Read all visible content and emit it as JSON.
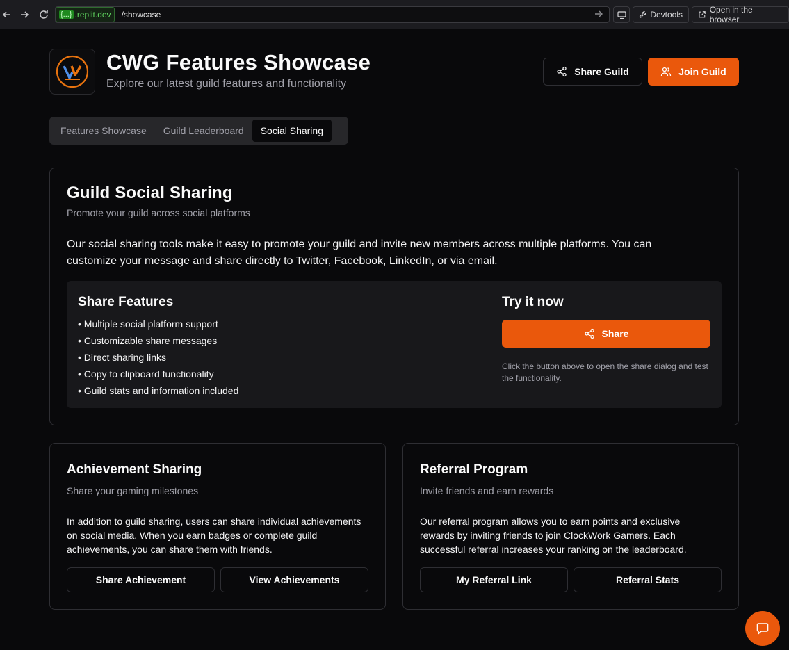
{
  "browser": {
    "url_domain_badge": "{...}",
    "url_domain": ".replit.dev",
    "url_path": "/showcase",
    "devtools_label": "Devtools",
    "open_browser_label": "Open in the browser"
  },
  "header": {
    "title": "CWG Features Showcase",
    "subtitle": "Explore our latest guild features and functionality",
    "share_guild_label": "Share Guild",
    "join_guild_label": "Join Guild"
  },
  "tabs": [
    {
      "label": "Features Showcase",
      "active": false
    },
    {
      "label": "Guild Leaderboard",
      "active": false
    },
    {
      "label": "Social Sharing",
      "active": true
    }
  ],
  "social_card": {
    "title": "Guild Social Sharing",
    "subtitle": "Promote your guild across social platforms",
    "body_line1": "Our social sharing tools make it easy to promote your guild and invite new members across multiple platforms. You can",
    "body_line2": "customize your message and share directly to Twitter, Facebook, LinkedIn, or via email.",
    "features_heading": "Share Features",
    "features": [
      "• Multiple social platform support",
      "• Customizable share messages",
      "• Direct sharing links",
      "• Copy to clipboard functionality",
      "• Guild stats and information included"
    ],
    "try_heading": "Try it now",
    "share_button_label": "Share",
    "try_note": "Click the button above to open the share dialog and test the functionality."
  },
  "achievement_card": {
    "title": "Achievement Sharing",
    "subtitle": "Share your gaming milestones",
    "body": "In addition to guild sharing, users can share individual achievements on social media. When you earn badges or complete guild achievements, you can share them with friends.",
    "button1": "Share Achievement",
    "button2": "View Achievements"
  },
  "referral_card": {
    "title": "Referral Program",
    "subtitle": "Invite friends and earn rewards",
    "body": "Our referral program allows you to earn points and exclusive rewards by inviting friends to join ClockWork Gamers. Each successful referral increases your ranking on the leaderboard.",
    "button1": "My Referral Link",
    "button2": "Referral Stats"
  },
  "colors": {
    "accent": "#ea580c",
    "background": "#09090b",
    "border": "#2e2e33"
  }
}
